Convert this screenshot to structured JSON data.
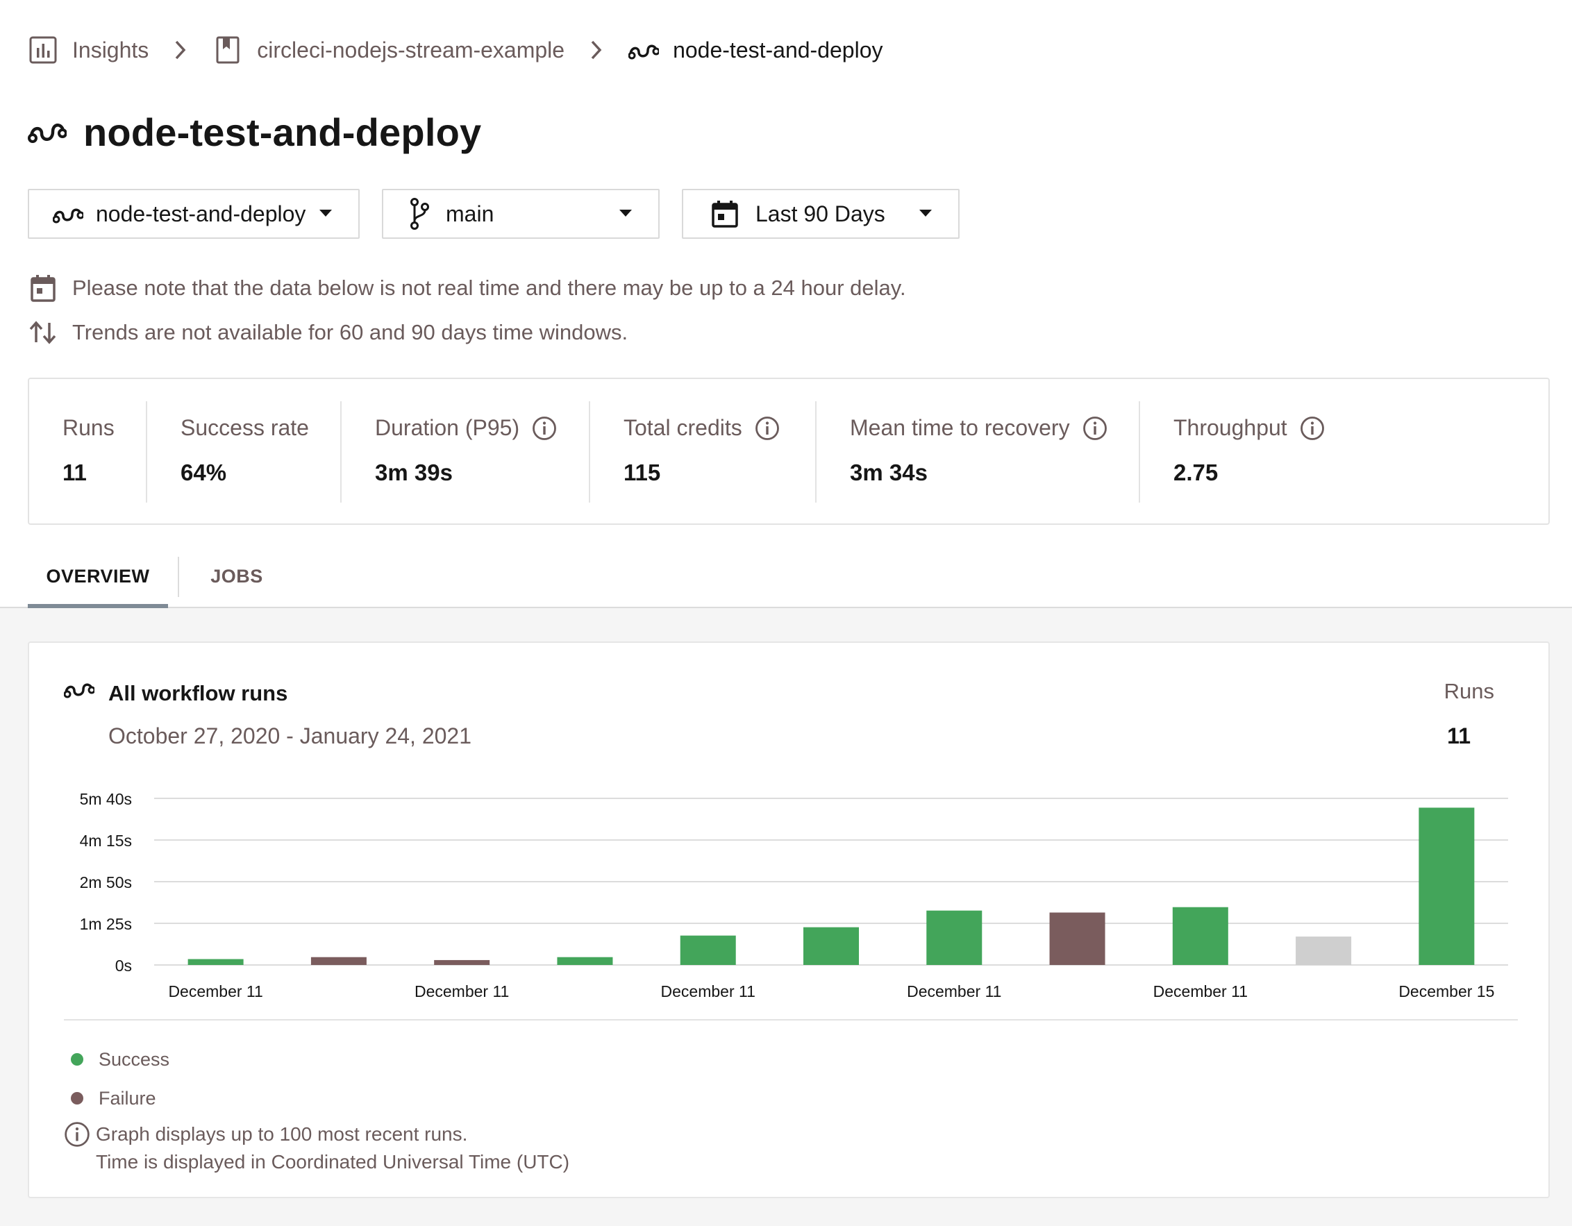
{
  "breadcrumb": {
    "insights": "Insights",
    "project": "circleci-nodejs-stream-example",
    "workflow": "node-test-and-deploy"
  },
  "page_title": "node-test-and-deploy",
  "filters": {
    "workflow": "node-test-and-deploy",
    "branch": "main",
    "range": "Last 90 Days"
  },
  "notices": {
    "delay": "Please note that the data below is not real time and there may be up to a 24 hour delay.",
    "trends": "Trends are not available for 60 and 90 days time windows."
  },
  "metrics": [
    {
      "label": "Runs",
      "value": "11",
      "info": false
    },
    {
      "label": "Success rate",
      "value": "64%",
      "info": false
    },
    {
      "label": "Duration (P95)",
      "value": "3m 39s",
      "info": true
    },
    {
      "label": "Total credits",
      "value": "115",
      "info": true
    },
    {
      "label": "Mean time to recovery",
      "value": "3m 34s",
      "info": true
    },
    {
      "label": "Throughput",
      "value": "2.75",
      "info": true
    }
  ],
  "tabs": [
    "OVERVIEW",
    "JOBS"
  ],
  "active_tab": "OVERVIEW",
  "card": {
    "title": "All workflow runs",
    "range": "October 27, 2020 - January 24, 2021",
    "runs_label": "Runs",
    "runs_value": "11"
  },
  "colors": {
    "success": "#43a55a",
    "failure": "#7a5c5d",
    "other": "#cfcfcf",
    "gridline": "#dcdcdc"
  },
  "chart_data": {
    "type": "bar",
    "title": "All workflow runs",
    "y_tick_labels": [
      "0s",
      "1m 25s",
      "2m 50s",
      "4m 15s",
      "5m 40s"
    ],
    "ylim_seconds": [
      0,
      340
    ],
    "x_tick_labels": [
      "December 11",
      "December 11",
      "December 11",
      "December 11",
      "December 11",
      "December 15"
    ],
    "bars": [
      {
        "duration_s": 12,
        "status": "success"
      },
      {
        "duration_s": 16,
        "status": "failure"
      },
      {
        "duration_s": 10,
        "status": "failure"
      },
      {
        "duration_s": 16,
        "status": "success"
      },
      {
        "duration_s": 60,
        "status": "success"
      },
      {
        "duration_s": 77,
        "status": "success"
      },
      {
        "duration_s": 111,
        "status": "success"
      },
      {
        "duration_s": 107,
        "status": "failure"
      },
      {
        "duration_s": 118,
        "status": "success"
      },
      {
        "duration_s": 58,
        "status": "other"
      },
      {
        "duration_s": 321,
        "status": "success"
      }
    ],
    "legend": [
      "Success",
      "Failure"
    ],
    "grid": true
  },
  "legend": {
    "success": "Success",
    "failure": "Failure"
  },
  "footnote": {
    "line1": "Graph displays up to 100 most recent runs.",
    "line2": "Time is displayed in Coordinated Universal Time (UTC)"
  }
}
